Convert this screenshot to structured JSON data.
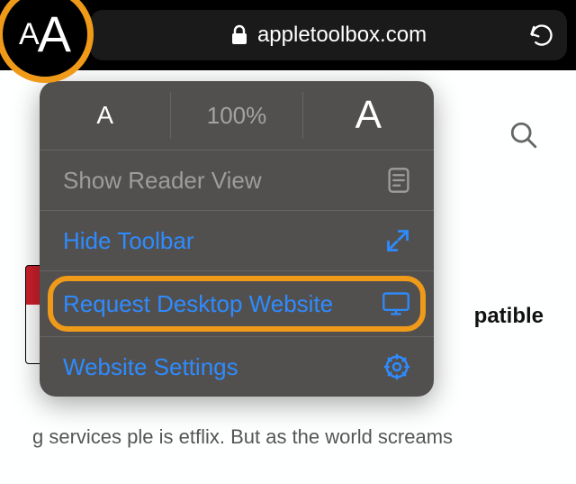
{
  "addressBar": {
    "domain": "appletoolbox.com"
  },
  "popover": {
    "zoom": {
      "percent_label": "100%"
    },
    "reader_label": "Show Reader View",
    "hide_toolbar_label": "Hide Toolbar",
    "request_desktop_label": "Request Desktop Website",
    "website_settings_label": "Website Settings"
  },
  "page": {
    "headline_fragment": "patible",
    "body_fragment": "g services ple is etflix. But as the world screams"
  }
}
